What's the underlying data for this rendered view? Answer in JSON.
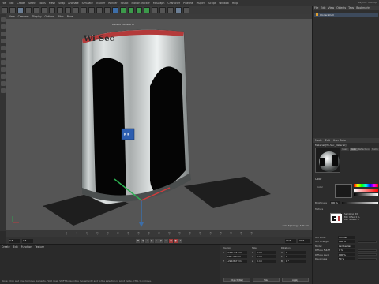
{
  "menu": {
    "items": [
      "File",
      "Edit",
      "Create",
      "Select",
      "Tools",
      "Mesh",
      "Snap",
      "Animate",
      "Simulate",
      "Tracker",
      "Render",
      "Sculpt",
      "Motion Tracker",
      "MoGraph",
      "Character",
      "Pipeline",
      "Plugins",
      "Script",
      "Window",
      "Help"
    ],
    "layout": "Layout: Startup"
  },
  "viewport": {
    "menu": [
      "View",
      "Cameras",
      "Display",
      "Options",
      "Filter",
      "Panel"
    ],
    "camera_label": "Default Camera ••",
    "grid_spacing": "Grid Spacing : 100 cm",
    "logo_text": "Wi-Sec"
  },
  "object_manager": {
    "tabs": [
      "File",
      "Edit",
      "View",
      "Objects",
      "Tags",
      "Bookmarks"
    ],
    "object_name": "Cloner.Shell"
  },
  "material_editor": {
    "tabs": [
      "Mode",
      "Edit",
      "User Data"
    ],
    "title": "Material [Wi-Sec_Material]",
    "channel_tabs": [
      "Basic",
      "Color",
      "Reflectance",
      "Bump"
    ],
    "color_section": "Color",
    "color_label": "Color",
    "brightness_label": "Brightness",
    "brightness_value": "100 %",
    "texture_label": "Texture",
    "texture_info": [
      "Sampling  MIP",
      "Blur Offset  0 %",
      "Blur Scale  0 %"
    ],
    "mix_mode_label": "Mix Mode",
    "mix_mode_value": "Normal",
    "mix_strength_label": "Mix Strength",
    "mix_strength_value": "100 %"
  },
  "timeline": {
    "ticks": [
      "0",
      "5",
      "10",
      "15",
      "20",
      "25",
      "30",
      "35",
      "40",
      "45",
      "50",
      "55",
      "60",
      "65",
      "70",
      "75",
      "80",
      "85",
      "90"
    ],
    "start_frame": "0 F",
    "end_frame": "90 F",
    "current_frame": "0 F",
    "end_field": "90 F"
  },
  "material_strip": {
    "tabs": [
      "Create",
      "Edit",
      "Function",
      "Texture"
    ],
    "status": "Move: Click and drag to move elements. Hold down SHIFT to quantize movement / add to the selection in point mode, CTRL to remove."
  },
  "coordinates": {
    "headers": [
      "Position",
      "Size",
      "Rotation"
    ],
    "position": [
      {
        "axis": "X",
        "value": "-168.722 cm"
      },
      {
        "axis": "Y",
        "value": "160.768 cm"
      },
      {
        "axis": "Z",
        "value": "-220.857 cm"
      }
    ],
    "size": [
      {
        "axis": "X",
        "value": "0 cm"
      },
      {
        "axis": "Y",
        "value": "0 cm"
      },
      {
        "axis": "Z",
        "value": "0 cm"
      }
    ],
    "rotation": [
      {
        "axis": "H",
        "value": "0 °"
      },
      {
        "axis": "P",
        "value": "0 °"
      },
      {
        "axis": "B",
        "value": "0 °"
      }
    ],
    "mode_button": "Object (Rel)",
    "size_button": "Size",
    "apply_button": "Apply"
  },
  "attr_bottom": {
    "rows": [
      {
        "label": "Mix Mode",
        "value": "Normal"
      },
      {
        "label": "Mix Strength",
        "value": "100 %"
      },
      {
        "label": "Model",
        "value": "Lambertian"
      },
      {
        "label": "Diffuse Falloff",
        "value": "0 %"
      },
      {
        "label": "Diffuse Level",
        "value": "100 %"
      },
      {
        "label": "Roughness",
        "value": "50 %"
      }
    ]
  },
  "colors": {
    "viewport_bg": "#555555",
    "floor": "#1e1e1e",
    "metal_light": "#d8dcdc",
    "metal_dark": "#7f8585",
    "red_stripe": "#b43a3a",
    "accent_blue": "#3d6ea8"
  }
}
